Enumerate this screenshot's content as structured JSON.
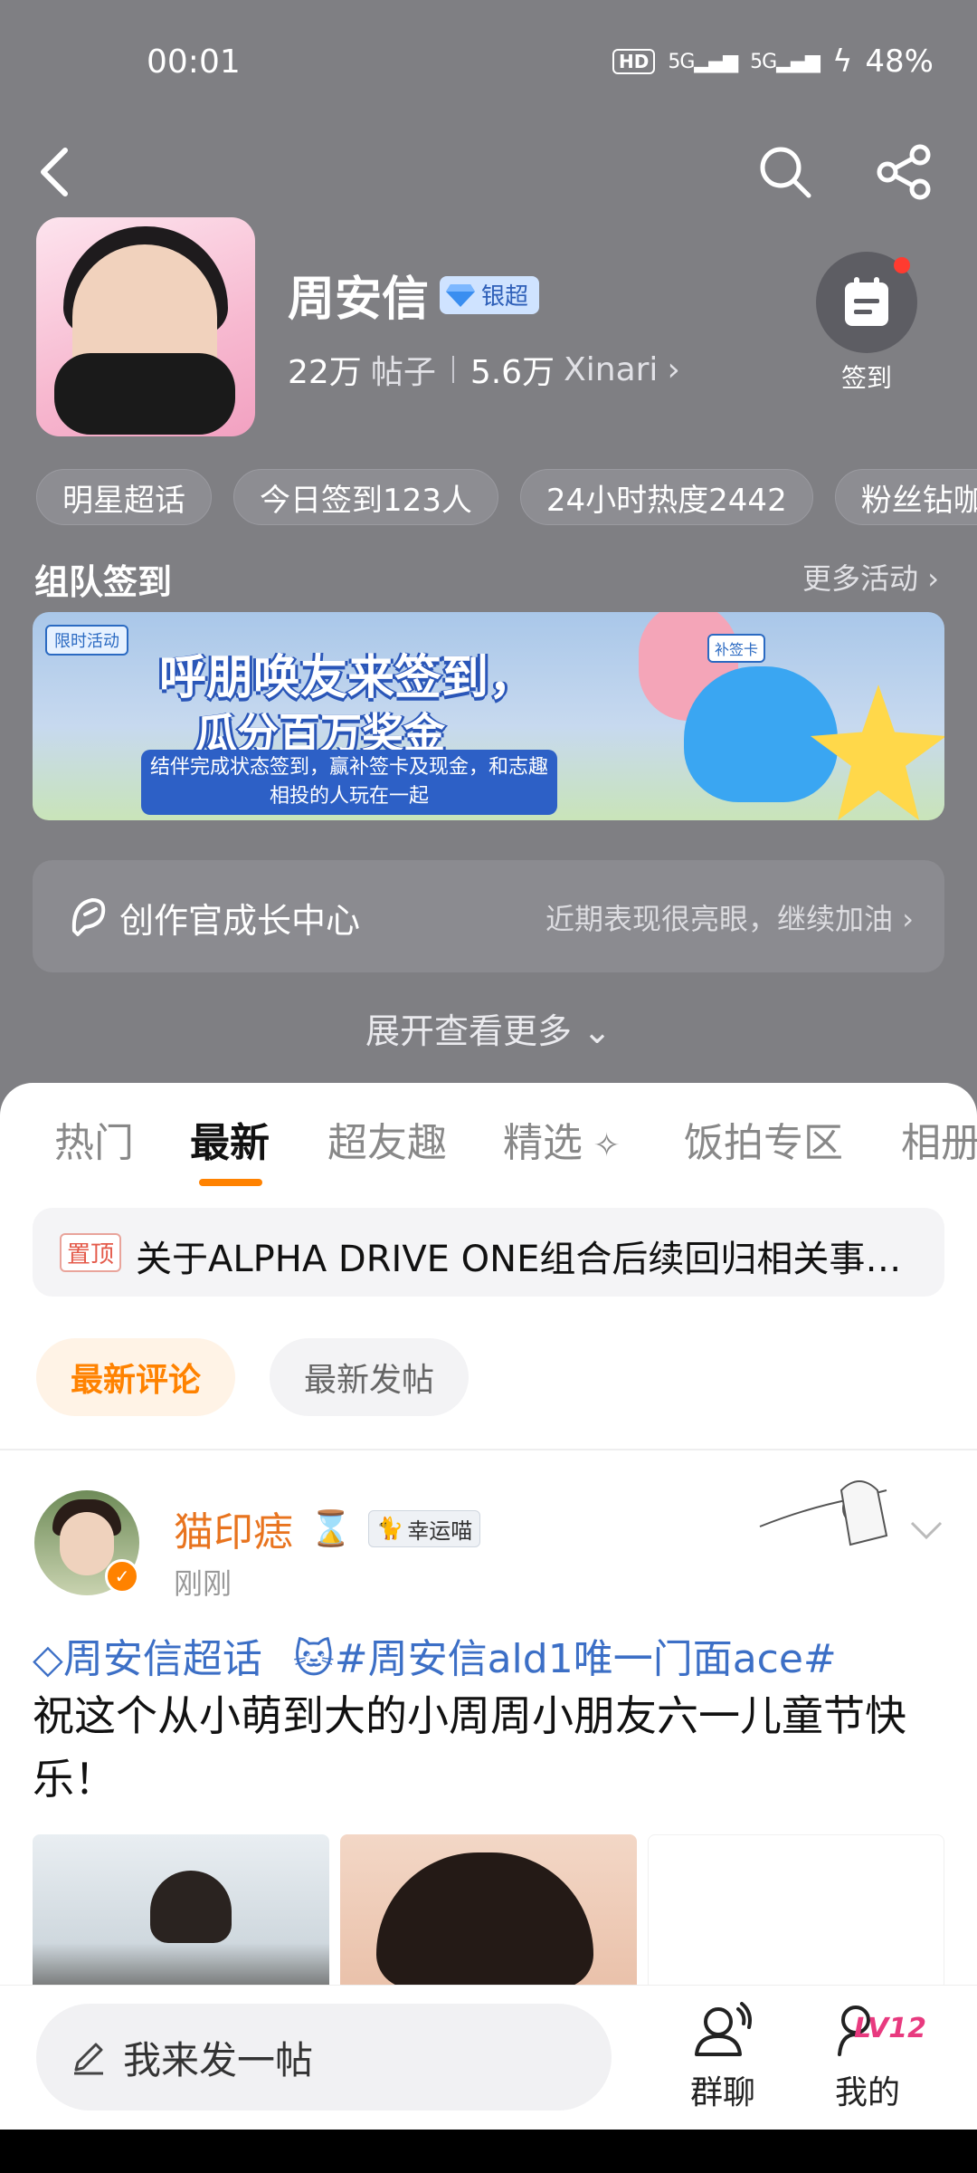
{
  "status_bar": {
    "time": "00:01",
    "hd": "HD",
    "net1": "5G",
    "net2": "5G",
    "battery": "48%"
  },
  "profile": {
    "name": "周安信",
    "badge": "银超",
    "posts_count": "22万",
    "posts_label": "帖子",
    "fans_count": "5.6万",
    "fans_name": "Xinari",
    "checkin_label": "签到"
  },
  "chips": [
    "明星超话",
    "今日签到123人",
    "24小时热度2442",
    "粉丝钻咖"
  ],
  "team_section": {
    "title": "组队签到",
    "more": "更多活动"
  },
  "banner": {
    "tag": "限时活动",
    "headline1": "呼朋唤友来签到，",
    "headline2": "瓜分百万奖金",
    "sub": "结伴完成状态签到，赢补签卡及现金，和志趣相投的人玩在一起",
    "card": "补签卡"
  },
  "creator": {
    "label": "创作官成长中心",
    "tip": "近期表现很亮眼，继续加油"
  },
  "expand": "展开查看更多",
  "tabs": [
    "热门",
    "最新",
    "超友趣",
    "精选",
    "饭拍专区",
    "相册"
  ],
  "pinned": {
    "tag": "置顶",
    "text": "关于ALPHA DRIVE ONE组合后续回归相关事…"
  },
  "filters": {
    "latest_comment": "最新评论",
    "latest_post": "最新发帖"
  },
  "post": {
    "username": "猫印痣",
    "lucky": "幸运喵",
    "time": "刚刚",
    "topic": "周安信超话",
    "hashtag": "🐱#周安信ald1唯一门面ace#",
    "body": "祝这个从小萌到大的小周周小朋友六一儿童节快乐！"
  },
  "bottom": {
    "compose_placeholder": "我来发一帖",
    "group_chat": "群聊",
    "mine": "我的",
    "level": "LV12"
  },
  "colors": {
    "accent": "#ff8200",
    "topic_blue": "#3c6fc6",
    "header_gray": "#7f7f83"
  }
}
